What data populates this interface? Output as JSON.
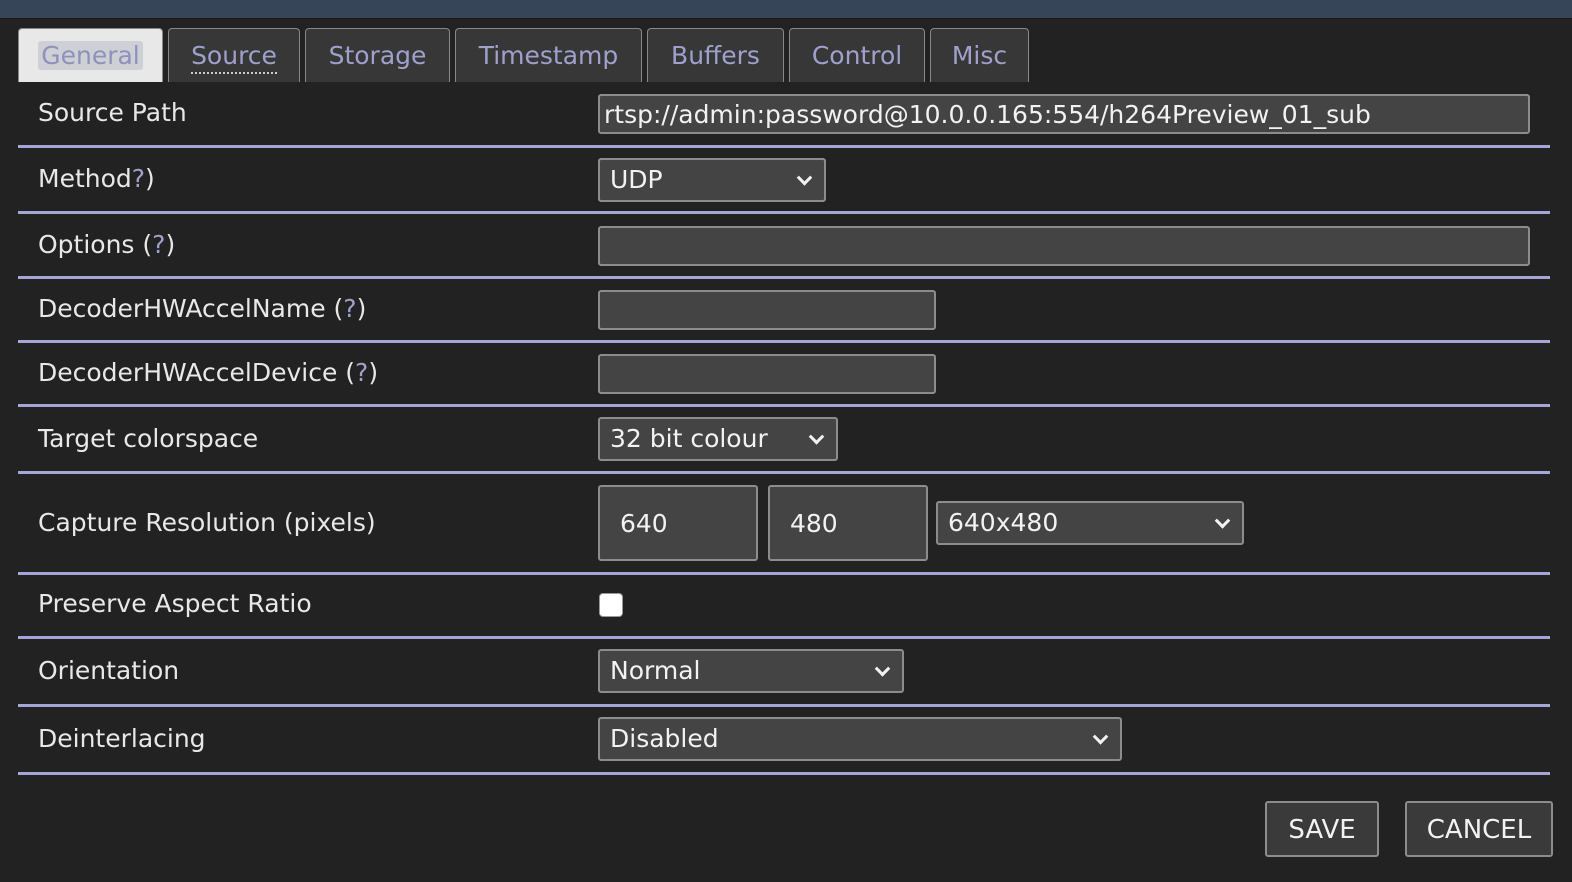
{
  "tabs": [
    {
      "label": "General"
    },
    {
      "label": "Source"
    },
    {
      "label": "Storage"
    },
    {
      "label": "Timestamp"
    },
    {
      "label": "Buffers"
    },
    {
      "label": "Control"
    },
    {
      "label": "Misc"
    }
  ],
  "form": {
    "source_path": {
      "label": "Source Path",
      "value": "rtsp://admin:password@10.0.0.165:554/h264Preview_01_sub"
    },
    "method": {
      "label": "Method",
      "help": "?",
      "suffix": ")",
      "value": "UDP"
    },
    "options": {
      "label": "Options (",
      "help": "?",
      "suffix": ")",
      "value": ""
    },
    "decoder_hwaccel_name": {
      "label": "DecoderHWAccelName (",
      "help": "?",
      "suffix": ")",
      "value": ""
    },
    "decoder_hwaccel_device": {
      "label": "DecoderHWAccelDevice (",
      "help": "?",
      "suffix": ")",
      "value": ""
    },
    "target_colorspace": {
      "label": "Target colorspace",
      "value": "32 bit colour"
    },
    "capture_resolution": {
      "label": "Capture Resolution (pixels)",
      "width": "640",
      "height": "480",
      "preset": "640x480"
    },
    "preserve_aspect_ratio": {
      "label": "Preserve Aspect Ratio",
      "checked": false
    },
    "orientation": {
      "label": "Orientation",
      "value": "Normal"
    },
    "deinterlacing": {
      "label": "Deinterlacing",
      "value": "Disabled"
    }
  },
  "buttons": {
    "save": "SAVE",
    "cancel": "CANCEL"
  },
  "colors": {
    "background": "#222222",
    "row_divider": "#a4a6d6",
    "help_link": "#9fa1cc",
    "tab_text": "#9fa1cc"
  }
}
